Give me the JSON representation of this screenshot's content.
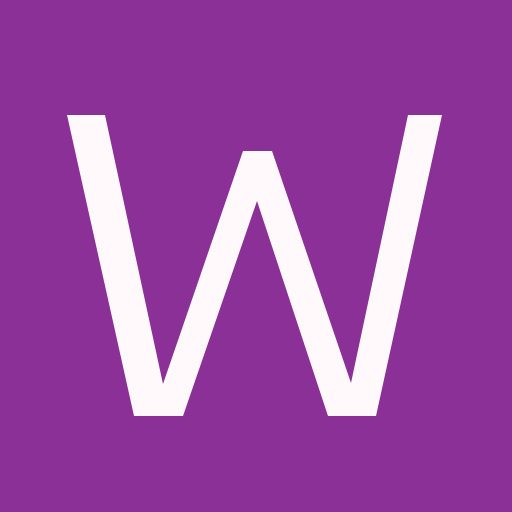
{
  "tile": {
    "letter": "W",
    "background_color": "#8b3097",
    "letter_color": "#fff9fb"
  }
}
